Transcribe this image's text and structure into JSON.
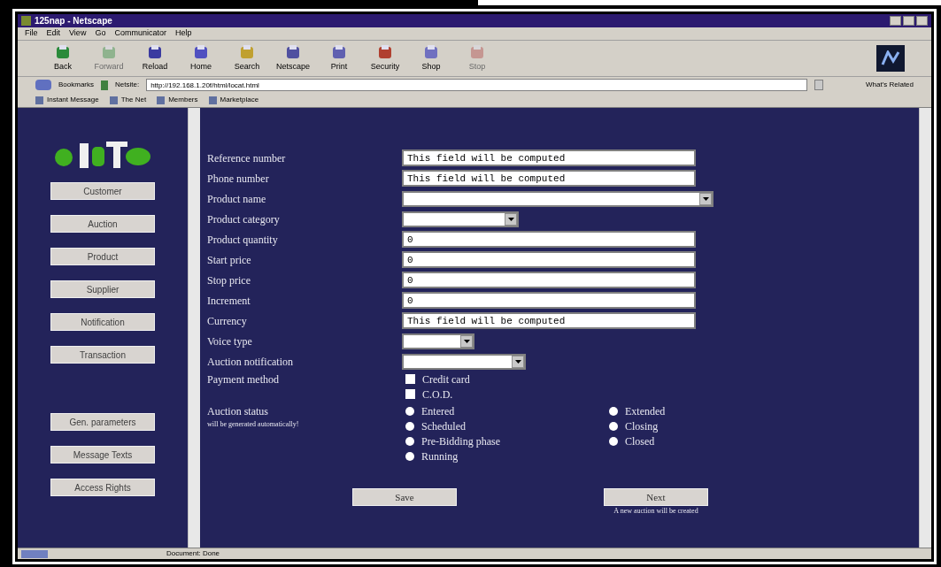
{
  "window": {
    "title": "125nap - Netscape"
  },
  "menu": [
    "File",
    "Edit",
    "View",
    "Go",
    "Communicator",
    "Help"
  ],
  "toolbar": [
    {
      "label": "Back",
      "disabled": false
    },
    {
      "label": "Forward",
      "disabled": true
    },
    {
      "label": "Reload",
      "disabled": false
    },
    {
      "label": "Home",
      "disabled": false
    },
    {
      "label": "Search",
      "disabled": false
    },
    {
      "label": "Netscape",
      "disabled": false
    },
    {
      "label": "Print",
      "disabled": false
    },
    {
      "label": "Security",
      "disabled": false
    },
    {
      "label": "Shop",
      "disabled": false
    },
    {
      "label": "Stop",
      "disabled": true
    }
  ],
  "location": {
    "bookmarks": "Bookmarks",
    "label": "Netsite:",
    "url": "http://192.168.1.20f/html/locat.html",
    "related": "What's Related"
  },
  "personal_toolbar": [
    "Instant Message",
    "The Net",
    "Members",
    "Marketplace"
  ],
  "sidebar": {
    "items": [
      "Customer",
      "Auction",
      "Product",
      "Supplier",
      "Notification",
      "Transaction"
    ],
    "lower_items": [
      "Gen. parameters",
      "Message Texts",
      "Access Rights"
    ]
  },
  "form": {
    "rows": [
      {
        "kind": "text",
        "label": "Reference number",
        "value": "This field will be computed"
      },
      {
        "kind": "text",
        "label": "Phone number",
        "value": "This field will be computed"
      },
      {
        "kind": "select",
        "label": "Product name"
      },
      {
        "kind": "select",
        "label": "Product category"
      },
      {
        "kind": "text",
        "label": "Product quantity",
        "value": "0"
      },
      {
        "kind": "text",
        "label": "Start price",
        "value": "0"
      },
      {
        "kind": "text",
        "label": "Stop price",
        "value": "0"
      },
      {
        "kind": "text",
        "label": "Increment",
        "value": "0"
      },
      {
        "kind": "text",
        "label": "Currency",
        "value": "This field will be computed"
      },
      {
        "kind": "select",
        "label": "Voice type"
      },
      {
        "kind": "select",
        "label": "Auction notification"
      }
    ],
    "payment": {
      "label": "Payment method",
      "options": [
        {
          "label": "Credit card",
          "checked": false
        },
        {
          "label": "C.O.D.",
          "checked": false
        }
      ]
    },
    "status": {
      "label": "Auction status",
      "note": "will be generated automatically!",
      "columns": [
        [
          {
            "label": "Entered",
            "selected": false
          },
          {
            "label": "Scheduled",
            "selected": false
          },
          {
            "label": "Pre-Bidding phase",
            "selected": false
          },
          {
            "label": "Running",
            "selected": false
          }
        ],
        [
          {
            "label": "Extended",
            "selected": false
          },
          {
            "label": "Closing",
            "selected": false
          },
          {
            "label": "Closed",
            "selected": false
          }
        ]
      ]
    },
    "save": "Save",
    "next": "Next",
    "next_note": "A new auction will be created"
  },
  "status_bar": "Document: Done"
}
